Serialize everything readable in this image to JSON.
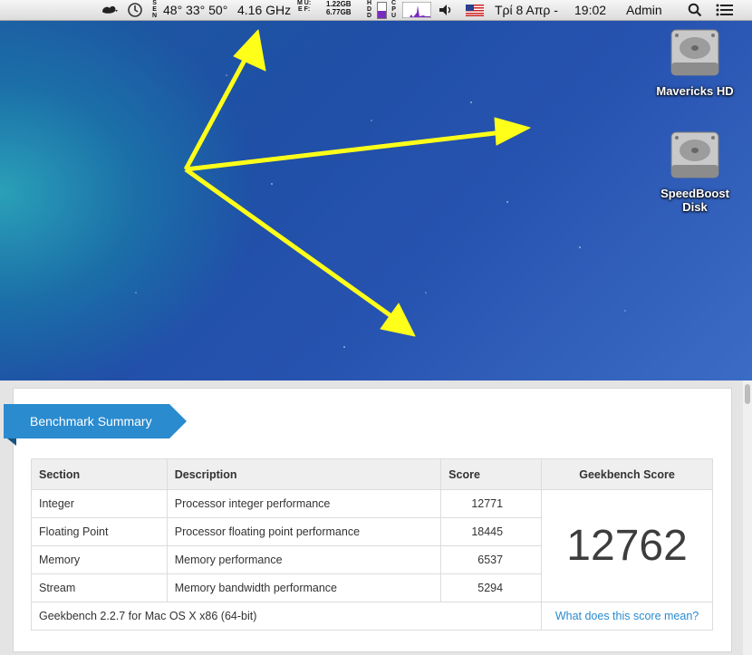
{
  "menubar": {
    "sensors_labels": [
      "S",
      "E",
      "N"
    ],
    "temperatures": "48° 33° 50°",
    "cpu_freq": "4.16 GHz",
    "mem_labels": [
      "M U:",
      "E F:"
    ],
    "mem_used": "1.22GB",
    "mem_free": "6.77GB",
    "hdd_label": [
      "H",
      "D",
      "D"
    ],
    "cpu_label": [
      "C",
      "P",
      "U"
    ],
    "date": "Τρί 8 Απρ -",
    "time": "19:02",
    "user": "Admin",
    "icons": [
      "cloud-app-icon",
      "time-machine-icon",
      "volume-icon",
      "us-flag-icon",
      "spotlight-icon",
      "notification-center-icon"
    ]
  },
  "desktop": {
    "drives": [
      {
        "label": "Mavericks HD"
      },
      {
        "label": "SpeedBoost\nDisk"
      }
    ]
  },
  "benchmark": {
    "title": "Benchmark Summary",
    "headers": {
      "section": "Section",
      "description": "Description",
      "score": "Score",
      "geekbench_score": "Geekbench Score"
    },
    "rows": [
      {
        "section": "Integer",
        "description": "Processor integer performance",
        "score": "12771"
      },
      {
        "section": "Floating Point",
        "description": "Processor floating point performance",
        "score": "18445"
      },
      {
        "section": "Memory",
        "description": "Memory performance",
        "score": "6537"
      },
      {
        "section": "Stream",
        "description": "Memory bandwidth performance",
        "score": "5294"
      }
    ],
    "total_score": "12762",
    "footer_text": "Geekbench 2.2.7 for Mac OS X x86 (64-bit)",
    "footer_link": "What does this score mean?"
  },
  "colors": {
    "accent": "#2a8bcf",
    "arrow": "#ffff1a",
    "cpu_graph": "#7a2bbf"
  }
}
